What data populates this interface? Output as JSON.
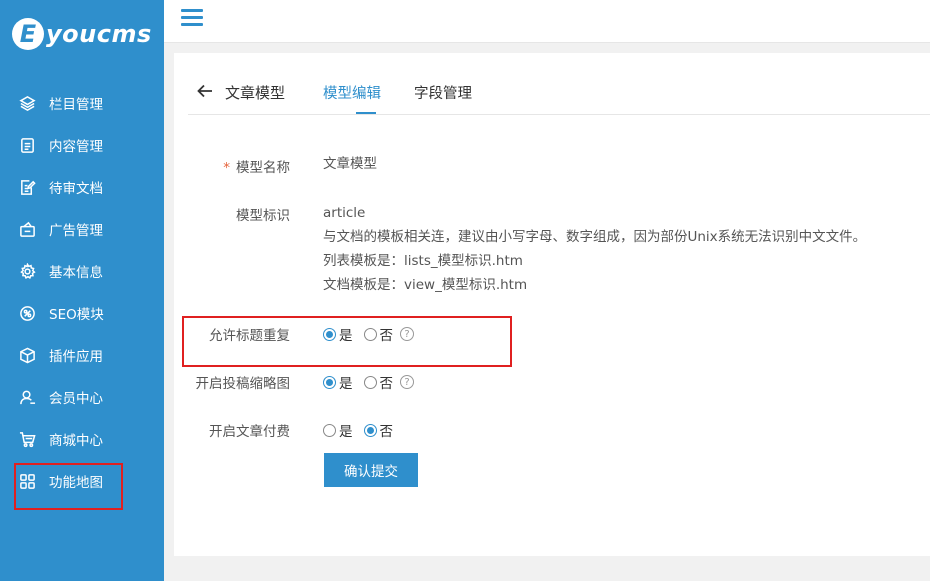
{
  "logo": {
    "letter": "E",
    "text": "youcms"
  },
  "sidebar": {
    "items": [
      {
        "label": "栏目管理",
        "icon": "layers-icon"
      },
      {
        "label": "内容管理",
        "icon": "document-icon"
      },
      {
        "label": "待审文档",
        "icon": "edit-document-icon"
      },
      {
        "label": "广告管理",
        "icon": "ad-icon"
      },
      {
        "label": "基本信息",
        "icon": "gear-icon"
      },
      {
        "label": "SEO模块",
        "icon": "seo-icon"
      },
      {
        "label": "插件应用",
        "icon": "cube-icon"
      },
      {
        "label": "会员中心",
        "icon": "user-icon"
      },
      {
        "label": "商城中心",
        "icon": "cart-icon"
      },
      {
        "label": "功能地图",
        "icon": "grid-icon"
      }
    ]
  },
  "tabs": {
    "title": "文章模型",
    "items": [
      "模型编辑",
      "字段管理"
    ]
  },
  "form": {
    "model_name": {
      "label": "模型名称",
      "required_mark": "*",
      "value": "文章模型"
    },
    "model_id": {
      "label": "模型标识",
      "value": "article",
      "hint": "与文档的模板相关连，建议由小写字母、数字组成，因为部份Unix系统无法识别中文文件。",
      "list_template": "列表模板是：lists_模型标识.htm",
      "doc_template": "文档模板是：view_模型标识.htm"
    },
    "allow_dup_title": {
      "label": "允许标题重复",
      "yes": "是",
      "no": "否",
      "selected": "yes",
      "help": "?"
    },
    "enable_thumb": {
      "label": "开启投稿缩略图",
      "yes": "是",
      "no": "否",
      "selected": "yes",
      "help": "?"
    },
    "enable_paid": {
      "label": "开启文章付费",
      "yes": "是",
      "no": "否",
      "selected": "no"
    },
    "submit_label": "确认提交"
  },
  "colors": {
    "accent": "#2f8fcc",
    "highlight_box": "#e02020",
    "required": "#e5623a"
  }
}
